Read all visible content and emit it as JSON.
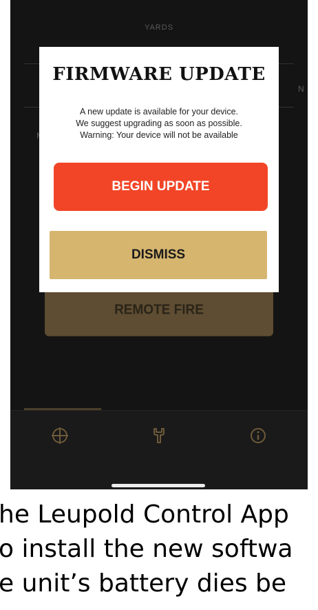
{
  "background": {
    "units_label": "YARDS",
    "side_left": "M",
    "side_right": "N"
  },
  "dialog": {
    "title": "FIRMWARE UPDATE",
    "message_lines": [
      "A new update is available for your device.",
      "We suggest upgrading as soon as possible.",
      "Warning: Your device will not be available"
    ],
    "primary_button": "BEGIN UPDATE",
    "secondary_button": "DISMISS"
  },
  "remote_fire_label": "REMOTE FIRE",
  "tabbar": {
    "tabs": [
      {
        "icon": "crosshair-icon",
        "active": true
      },
      {
        "icon": "wrench-icon",
        "active": false
      },
      {
        "icon": "info-icon",
        "active": false
      }
    ]
  },
  "caption": {
    "lines": [
      "he Leupold Control App",
      "o install the new softwa",
      "e unit’s battery dies be"
    ]
  },
  "colors": {
    "screen_bg": "#141414",
    "primary_red": "#f24527",
    "dismiss_gold": "#d6b56f",
    "remote_fire_bg": "#5e4d32",
    "tab_icon": "#6e5a3a"
  }
}
